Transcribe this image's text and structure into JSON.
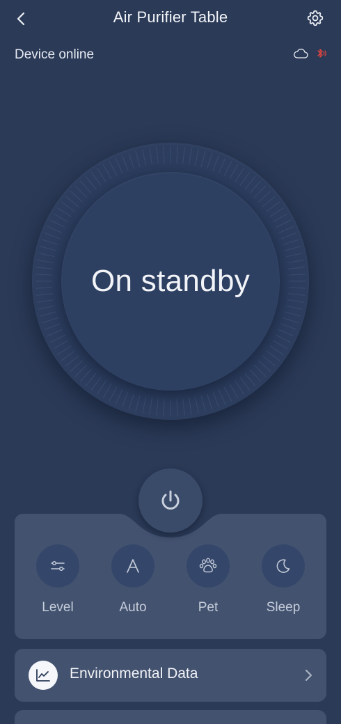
{
  "header": {
    "title": "Air Purifier Table",
    "back_icon": "chevron-left-icon",
    "settings_icon": "gear-icon"
  },
  "status": {
    "text": "Device online",
    "icons": [
      "cloud-icon",
      "bluetooth-icon"
    ],
    "bluetooth_color": "#e0453f"
  },
  "dial": {
    "state_text": "On standby"
  },
  "power": {
    "icon": "power-icon"
  },
  "modes": [
    {
      "label": "Level",
      "icon": "sliders-icon"
    },
    {
      "label": "Auto",
      "icon": "letter-a-icon"
    },
    {
      "label": "Pet",
      "icon": "paw-icon"
    },
    {
      "label": "Sleep",
      "icon": "moon-icon"
    }
  ],
  "environment": {
    "label": "Environmental Data",
    "icon": "line-chart-icon",
    "chevron_icon": "chevron-right-icon"
  },
  "colors": {
    "background": "#2b3a57",
    "panel": "#43526f",
    "text": "#eef1f6"
  }
}
